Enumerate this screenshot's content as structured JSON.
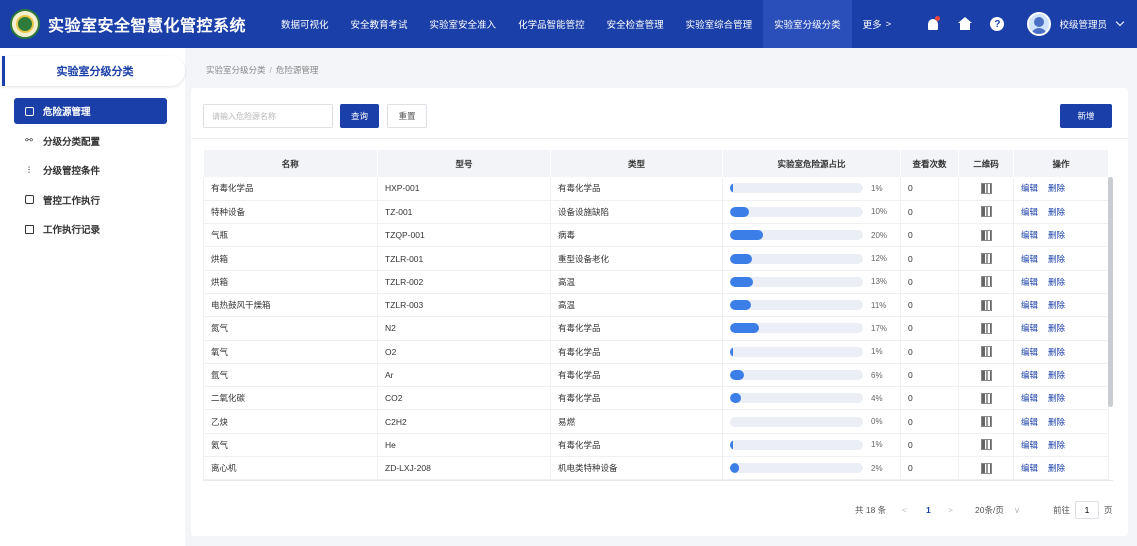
{
  "header": {
    "title": "实验室安全智慧化管控系统",
    "nav": [
      {
        "label": "数据可视化"
      },
      {
        "label": "安全教育考试"
      },
      {
        "label": "实验室安全准入"
      },
      {
        "label": "化学品智能管控"
      },
      {
        "label": "安全检查管理"
      },
      {
        "label": "实验室综合管理"
      },
      {
        "label": "实验室分级分类"
      }
    ],
    "active_nav": "实验室分级分类",
    "more_label": "更多",
    "more_arrow": ">",
    "help_glyph": "?",
    "user_name": "校级管理员",
    "icons": [
      "bell-icon",
      "home-icon",
      "help-icon",
      "avatar",
      "chevron-down-icon"
    ],
    "colors": {
      "primary": "#1a3fa8",
      "active_nav": "#2a4fba",
      "notification": "#e8473f"
    }
  },
  "sidebar": {
    "title": "实验室分级分类",
    "items": [
      {
        "label": "危险源管理",
        "icon": "monitor-icon",
        "active": true
      },
      {
        "label": "分级分类配置",
        "icon": "tree-icon",
        "active": false
      },
      {
        "label": "分级管控条件",
        "icon": "sliders-icon",
        "active": false
      },
      {
        "label": "管控工作执行",
        "icon": "book-icon",
        "active": false
      },
      {
        "label": "工作执行记录",
        "icon": "document-icon",
        "active": false
      }
    ]
  },
  "breadcrumb": {
    "items": [
      "实验室分级分类",
      "危险源管理"
    ],
    "separator": "/"
  },
  "toolbar": {
    "search_placeholder": "请输入危险源名称",
    "search_value": "",
    "query_label": "查询",
    "reset_label": "重置",
    "new_label": "新增"
  },
  "table": {
    "columns": [
      "名称",
      "型号",
      "类型",
      "实验室危险源占比",
      "查看次数",
      "二维码",
      "操作"
    ],
    "rows": [
      {
        "name": "有毒化学品",
        "model": "HXP-001",
        "type": "有毒化学品",
        "percent": 1,
        "pct_label": "1%",
        "views": "0"
      },
      {
        "name": "特种设备",
        "model": "TZ-001",
        "type": "设备设施缺陷",
        "percent": 10,
        "pct_label": "10%",
        "views": "0"
      },
      {
        "name": "气瓶",
        "model": "TZQP-001",
        "type": "病毒",
        "percent": 20,
        "pct_label": "20%",
        "views": "0"
      },
      {
        "name": "烘箱",
        "model": "TZLR-001",
        "type": "重型设备老化",
        "percent": 12,
        "pct_label": "12%",
        "views": "0"
      },
      {
        "name": "烘箱",
        "model": "TZLR-002",
        "type": "高温",
        "percent": 13,
        "pct_label": "13%",
        "views": "0"
      },
      {
        "name": "电热鼓风干燥箱",
        "model": "TZLR-003",
        "type": "高温",
        "percent": 11,
        "pct_label": "11%",
        "views": "0"
      },
      {
        "name": "氮气",
        "model": "N2",
        "type": "有毒化学品",
        "percent": 17,
        "pct_label": "17%",
        "views": "0"
      },
      {
        "name": "氧气",
        "model": "O2",
        "type": "有毒化学品",
        "percent": 1,
        "pct_label": "1%",
        "views": "0"
      },
      {
        "name": "氩气",
        "model": "Ar",
        "type": "有毒化学品",
        "percent": 6,
        "pct_label": "6%",
        "views": "0"
      },
      {
        "name": "二氧化碳",
        "model": "CO2",
        "type": "有毒化学品",
        "percent": 4,
        "pct_label": "4%",
        "views": "0"
      },
      {
        "name": "乙炔",
        "model": "C2H2",
        "type": "易燃",
        "percent": 0,
        "pct_label": "0%",
        "views": "0"
      },
      {
        "name": "氦气",
        "model": "He",
        "type": "有毒化学品",
        "percent": 1,
        "pct_label": "1%",
        "views": "0"
      },
      {
        "name": "离心机",
        "model": "ZD-LXJ-208",
        "type": "机电类特种设备",
        "percent": 2,
        "pct_label": "2%",
        "views": "0"
      }
    ],
    "action_edit": "编辑",
    "action_delete": "删除",
    "progress_color": "#3b7ee8"
  },
  "pagination": {
    "total_label": "共 18 条",
    "prev": "<",
    "current_page": "1",
    "next": ">",
    "page_size": "20条/页",
    "page_size_arrow": "∨",
    "goto_label": "前往",
    "goto_value": "1",
    "page_unit": "页"
  }
}
